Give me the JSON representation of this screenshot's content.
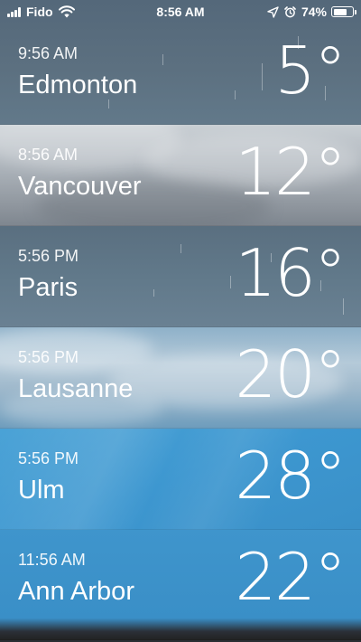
{
  "status_bar": {
    "carrier": "Fido",
    "time": "8:56 AM",
    "battery_percent": "74%",
    "battery_level": 0.74
  },
  "cities": [
    {
      "time": "9:56 AM",
      "name": "Edmonton",
      "temp": "5°",
      "condition_icon": "rain"
    },
    {
      "time": "8:56 AM",
      "name": "Vancouver",
      "temp": "12°",
      "condition_icon": "cloudy"
    },
    {
      "time": "5:56 PM",
      "name": "Paris",
      "temp": "16°",
      "condition_icon": "rain"
    },
    {
      "time": "5:56 PM",
      "name": "Lausanne",
      "temp": "20°",
      "condition_icon": "partly-cloudy"
    },
    {
      "time": "5:56 PM",
      "name": "Ulm",
      "temp": "28°",
      "condition_icon": "sunny"
    },
    {
      "time": "11:56 AM",
      "name": "Ann Arbor",
      "temp": "22°",
      "condition_icon": "sunny"
    }
  ]
}
